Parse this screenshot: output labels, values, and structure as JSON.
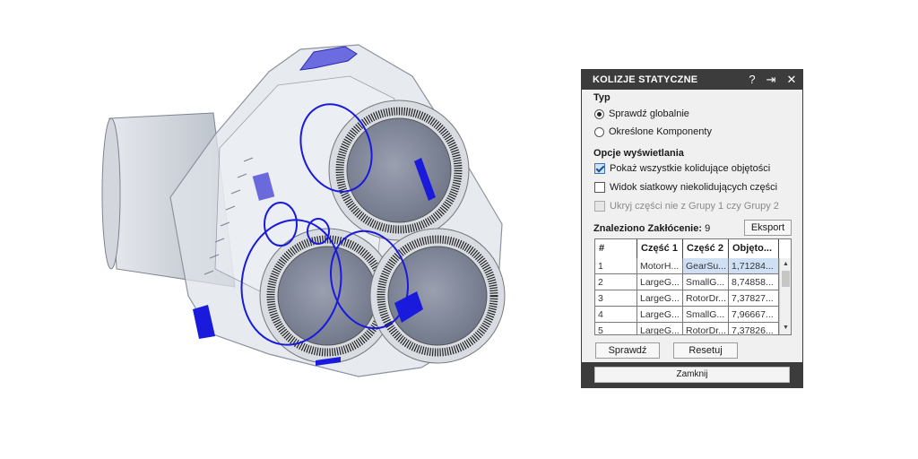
{
  "dialog": {
    "title": "KOLIZJE STATYCZNE",
    "icons": [
      "help-icon",
      "pin-icon",
      "close-icon"
    ],
    "type_section": "Typ",
    "radio_global": "Sprawdź globalnie",
    "radio_specific": "Określone Komponenty",
    "display_section": "Opcje wyświetlania",
    "opt_show_all": "Pokaż wszystkie kolidujące objętości",
    "opt_wireframe": "Widok siatkowy niekolidujących części",
    "opt_hide": "Ukryj części nie z Grupy 1 czy Grupy 2",
    "found_label": "Znaleziono Zakłócenie:",
    "found_count": "9",
    "export_button": "Eksport",
    "check_button": "Sprawdź",
    "reset_button": "Resetuj",
    "close_button": "Zamknij"
  },
  "table": {
    "headers": [
      "#",
      "Część 1",
      "Część 2",
      "Objęto..."
    ],
    "rows": [
      [
        "1",
        "MotorH...",
        "GearSu...",
        "1,71284..."
      ],
      [
        "2",
        "LargeG...",
        "SmallG...",
        "8,74858..."
      ],
      [
        "3",
        "LargeG...",
        "RotorDr...",
        "7,37827..."
      ],
      [
        "4",
        "LargeG...",
        "SmallG...",
        "7,96667..."
      ],
      [
        "5",
        "LargeG...",
        "RotorDr...",
        "7,37826..."
      ]
    ]
  },
  "colors": {
    "title_bar": "#3c3c3c",
    "dialog_bg": "#f0f0f0",
    "selected_row": "#cfe0f5",
    "interference": "#1a1adc"
  }
}
